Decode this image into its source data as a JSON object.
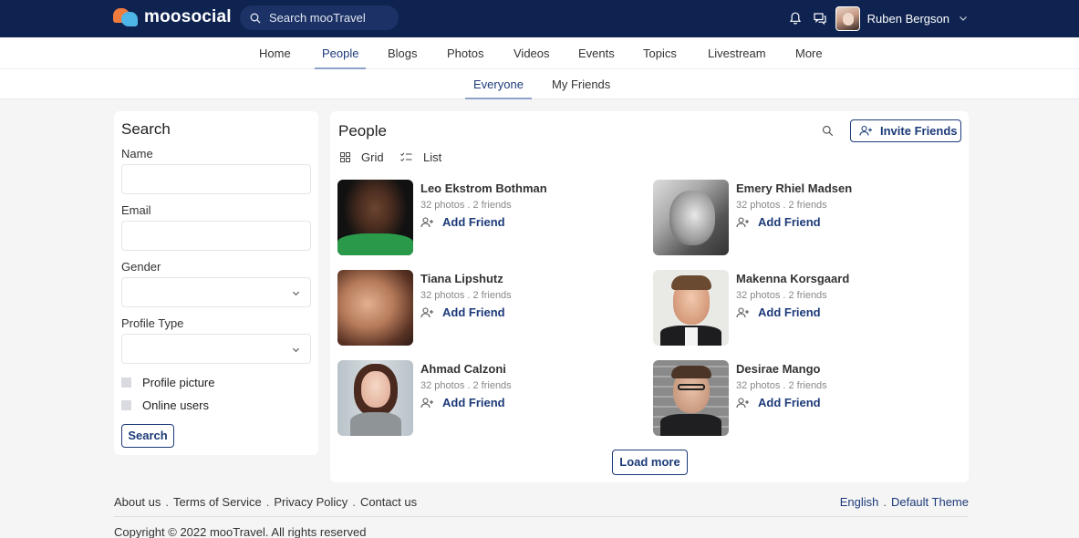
{
  "app": {
    "logo_text": "moosocial",
    "search_placeholder": "Search mooTravel",
    "user_name": "Ruben Bergson"
  },
  "nav": {
    "items": [
      "Home",
      "People",
      "Blogs",
      "Photos",
      "Videos",
      "Events",
      "Topics",
      "Livestream",
      "More"
    ],
    "active": "People"
  },
  "subnav": {
    "items": [
      "Everyone",
      "My Friends"
    ],
    "active": "Everyone"
  },
  "search_panel": {
    "title": "Search",
    "name_label": "Name",
    "name_value": "",
    "email_label": "Email",
    "email_value": "",
    "gender_label": "Gender",
    "gender_value": "",
    "profile_type_label": "Profile Type",
    "profile_type_value": "",
    "checkboxes": [
      {
        "label": "Profile picture",
        "checked": false
      },
      {
        "label": "Online users",
        "checked": false
      }
    ],
    "search_button": "Search"
  },
  "people_panel": {
    "title": "People",
    "invite_button": "Invite Friends",
    "view_grid": "Grid",
    "view_list": "List",
    "people": [
      {
        "name": "Leo Ekstrom Bothman",
        "meta": "32 photos . 2 friends",
        "action": "Add Friend"
      },
      {
        "name": "Emery Rhiel Madsen",
        "meta": "32 photos . 2 friends",
        "action": "Add Friend"
      },
      {
        "name": "Tiana Lipshutz",
        "meta": "32 photos . 2 friends",
        "action": "Add Friend"
      },
      {
        "name": "Makenna Korsgaard",
        "meta": "32 photos . 2 friends",
        "action": "Add Friend"
      },
      {
        "name": "Ahmad Calzoni",
        "meta": "32 photos . 2 friends",
        "action": "Add Friend"
      },
      {
        "name": "Desirae Mango",
        "meta": "32 photos . 2 friends",
        "action": "Add Friend"
      }
    ],
    "load_more": "Load more"
  },
  "footer": {
    "links": [
      "About us",
      "Terms of Service",
      "Privacy Policy",
      "Contact us"
    ],
    "language": "English",
    "theme": "Default Theme",
    "separator": ".",
    "copyright": "Copyright © 2022 mooTravel. All rights reserved"
  },
  "icons": {
    "logo": "speech-bubbles-logo",
    "search": "search-icon",
    "notifications": "bell-icon",
    "messages": "chat-icon",
    "dropdown": "chevron-down-icon",
    "invite": "add-user-icon",
    "grid": "grid-icon",
    "list": "list-icon"
  },
  "colors": {
    "topbar": "#0f2350",
    "accent": "#1c3a78",
    "logo_orange": "#f07b3f",
    "logo_blue": "#4fb7e8",
    "page_bg": "#f5f5f6"
  }
}
